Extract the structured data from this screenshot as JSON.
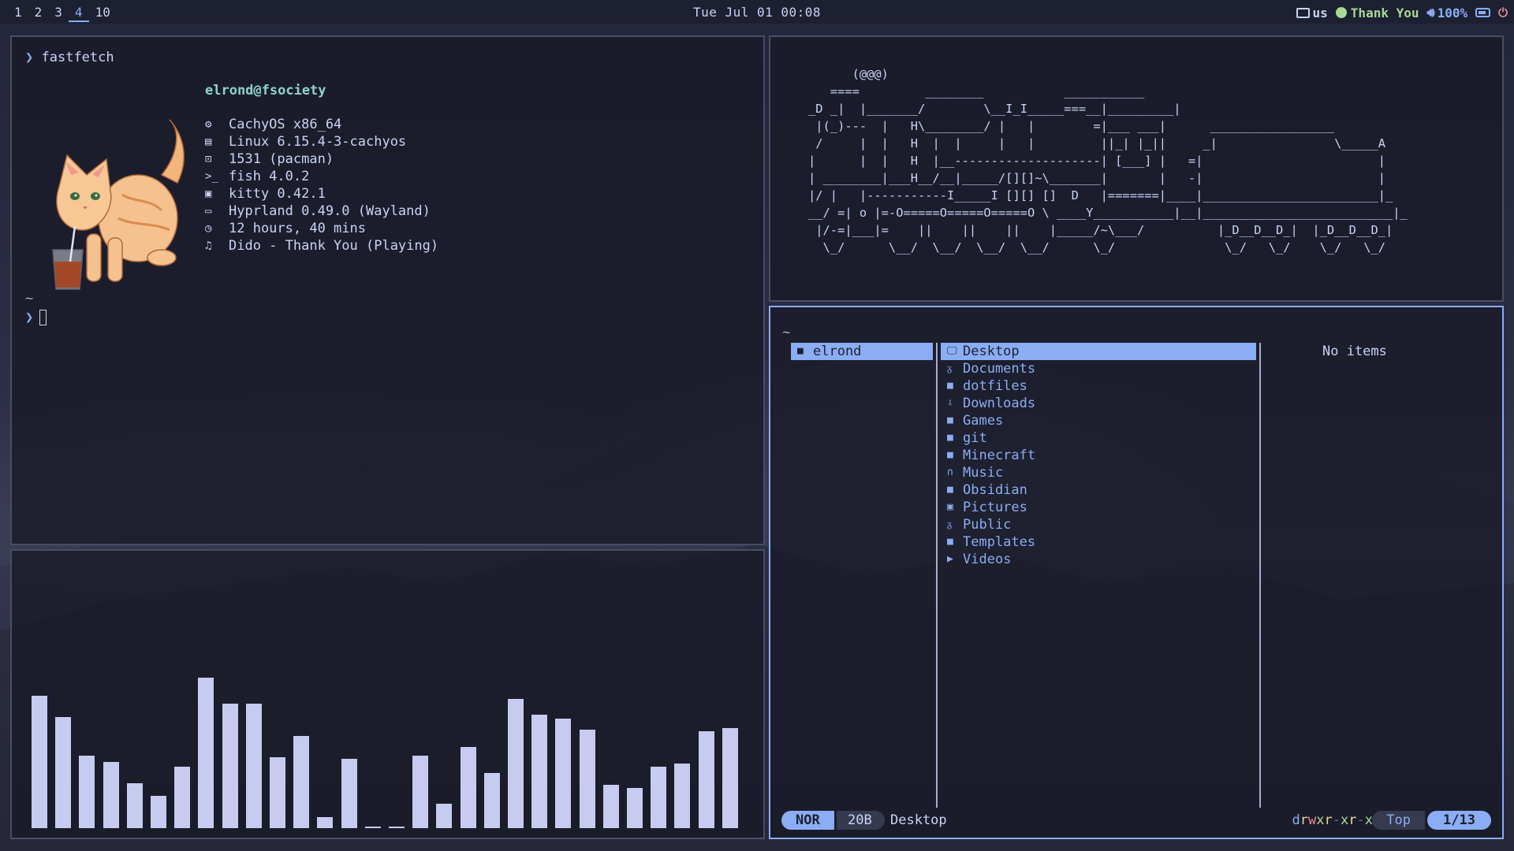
{
  "topbar": {
    "workspaces": [
      "1",
      "2",
      "3",
      "4",
      "10"
    ],
    "active_workspace": "4",
    "clock": "Tue Jul 01 00:08",
    "keyboard_layout": "us",
    "now_playing": "Thank You",
    "volume": "100%"
  },
  "fastfetch": {
    "command": "fastfetch",
    "user_host": "elrond@fsociety",
    "rows": [
      {
        "icon": "gear-icon",
        "glyph": "⚙",
        "text": "CachyOS x86_64"
      },
      {
        "icon": "server-icon",
        "glyph": "▤",
        "text": "Linux 6.15.4-3-cachyos"
      },
      {
        "icon": "package-icon",
        "glyph": "⊡",
        "text": "1531 (pacman)"
      },
      {
        "icon": "shell-icon",
        "glyph": ">_",
        "text": "fish 4.0.2"
      },
      {
        "icon": "terminal-icon",
        "glyph": "▣",
        "text": "kitty 0.42.1"
      },
      {
        "icon": "window-icon",
        "glyph": "▭",
        "text": "Hyprland 0.49.0 (Wayland)"
      },
      {
        "icon": "clock-icon",
        "glyph": "◷",
        "text": "12 hours, 40 mins"
      },
      {
        "icon": "music-icon",
        "glyph": "♫",
        "text": "Dido - Thank You (Playing)"
      }
    ],
    "cwd": "~"
  },
  "visualizer": {
    "levels": [
      0.82,
      0.69,
      0.45,
      0.41,
      0.28,
      0.2,
      0.38,
      0.93,
      0.77,
      0.77,
      0.44,
      0.57,
      0.07,
      0.43,
      0.01,
      0.01,
      0.45,
      0.15,
      0.5,
      0.34,
      0.8,
      0.7,
      0.68,
      0.61,
      0.27,
      0.25,
      0.38,
      0.4,
      0.6,
      0.62
    ]
  },
  "ascii_train": "      (@@@)\n   ====         ________           ___________\n_D _|  |_______/        \\__I_I_____===__|_________|\n |(_)---  |   H\\________/ |   |        =|___ ___|      _________________\n /     |  |   H  |  |     |   |         ||_| |_||     _|                \\_____A\n|      |  |   H  |__--------------------| [___] |   =|                        |\n| ________|___H__/__|_____/[][]~\\_______|       |   -|                        |\n|/ |   |-----------I_____I [][] []  D   |=======|____|________________________|_\n__/ =| o |=-O=====O=====O=====O \\ ____Y___________|__|__________________________|_\n |/-=|___|=    ||    ||    ||    |_____/~\\___/          |_D__D__D_|  |_D__D__D_|\n  \\_/      \\__/  \\__/  \\__/  \\__/      \\_/               \\_/   \\_/    \\_/   \\_/",
  "yazi": {
    "path": "~",
    "parent": [
      {
        "label": "elrond",
        "icon": "folder-icon"
      }
    ],
    "entries": [
      {
        "label": "Desktop",
        "icon": "desktop-icon",
        "glyph": "🖵"
      },
      {
        "label": "Documents",
        "icon": "document-icon",
        "glyph": "ᵹ"
      },
      {
        "label": "dotfiles",
        "icon": "folder-icon",
        "glyph": "■"
      },
      {
        "label": "Downloads",
        "icon": "download-icon",
        "glyph": "⇩"
      },
      {
        "label": "Games",
        "icon": "folder-icon",
        "glyph": "■"
      },
      {
        "label": "git",
        "icon": "folder-icon",
        "glyph": "■"
      },
      {
        "label": "Minecraft",
        "icon": "folder-icon",
        "glyph": "■"
      },
      {
        "label": "Music",
        "icon": "headphones-icon",
        "glyph": "∩"
      },
      {
        "label": "Obsidian",
        "icon": "folder-icon",
        "glyph": "■"
      },
      {
        "label": "Pictures",
        "icon": "picture-icon",
        "glyph": "▣"
      },
      {
        "label": "Public",
        "icon": "public-icon",
        "glyph": "ᵹ"
      },
      {
        "label": "Templates",
        "icon": "folder-icon",
        "glyph": "■"
      },
      {
        "label": "Videos",
        "icon": "video-icon",
        "glyph": "▶"
      }
    ],
    "preview": "No items",
    "status": {
      "mode": "NOR",
      "size": "20B",
      "name": "Desktop",
      "permissions": "drwxr-xr-x",
      "scroll": "Top",
      "position": "1/13"
    }
  },
  "colors": {
    "accent": "#8aadf4",
    "text": "#cad3f5",
    "teal": "#8bd5ca",
    "green": "#a6da95",
    "red": "#ed8796",
    "yellow": "#eed49f",
    "bar": "#c6cbef"
  }
}
